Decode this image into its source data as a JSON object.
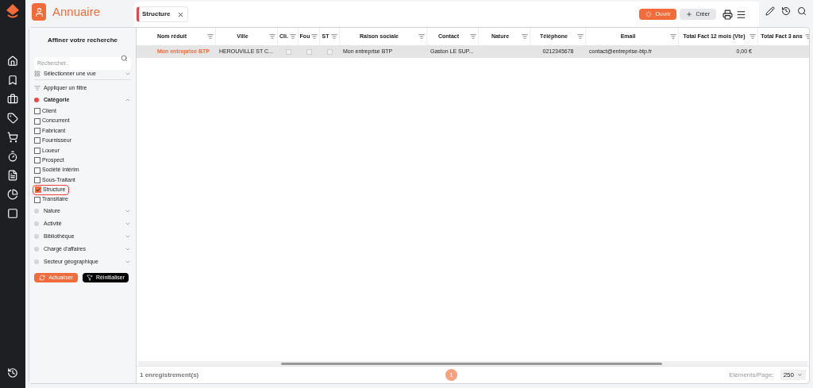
{
  "app": {
    "title": "Annuaire"
  },
  "tabs": [
    {
      "label": "Structure",
      "selected": true
    }
  ],
  "toolbar": {
    "open_button": "Ouvrir",
    "create_button": "Créer"
  },
  "filter_panel": {
    "title": "Affiner votre recherche",
    "search": {
      "placeholder": "Rechercher.."
    },
    "view_select": "Sélectionner une vue",
    "apply_filter": "Appliquer un filtre",
    "groups": [
      {
        "label": "Catégorie",
        "expanded": true,
        "active": true,
        "options": [
          {
            "label": "Client",
            "checked": false
          },
          {
            "label": "Concurrent",
            "checked": false
          },
          {
            "label": "Fabricant",
            "checked": false
          },
          {
            "label": "Fournisseur",
            "checked": false
          },
          {
            "label": "Loueur",
            "checked": false
          },
          {
            "label": "Prospect",
            "checked": false
          },
          {
            "label": "Société Intérim",
            "checked": false
          },
          {
            "label": "Sous-Traitant",
            "checked": false
          },
          {
            "label": "Structure",
            "checked": true
          },
          {
            "label": "Transitaire",
            "checked": false
          }
        ]
      },
      {
        "label": "Nature",
        "expanded": false,
        "active": false
      },
      {
        "label": "Activité",
        "expanded": false,
        "active": false
      },
      {
        "label": "Bibliothèque",
        "expanded": false,
        "active": false
      },
      {
        "label": "Chargé d'affaires",
        "expanded": false,
        "active": false
      },
      {
        "label": "Secteur géographique",
        "expanded": false,
        "active": false
      }
    ],
    "refresh_button": "Actualiser",
    "reset_button": "Réinitialiser"
  },
  "table": {
    "columns": [
      {
        "label": "Nom réduit",
        "kind": "link"
      },
      {
        "label": "Ville",
        "kind": "text"
      },
      {
        "label": "Cli.",
        "kind": "check"
      },
      {
        "label": "Fou",
        "kind": "check"
      },
      {
        "label": "ST",
        "kind": "check"
      },
      {
        "label": "Raison sociale",
        "kind": "text"
      },
      {
        "label": "Contact",
        "kind": "text"
      },
      {
        "label": "Nature",
        "kind": "text"
      },
      {
        "label": "Téléphone",
        "kind": "text"
      },
      {
        "label": "Email",
        "kind": "text"
      },
      {
        "label": "Total Fact 12 mois (Vte)",
        "kind": "text"
      },
      {
        "label": "Total Fact 3 ans",
        "kind": "text"
      }
    ],
    "rows": [
      {
        "selected": true,
        "cells": [
          {
            "text": "Mon entreprise BTP"
          },
          {
            "text": "HEROUVILLE ST C..."
          },
          {
            "checked": false
          },
          {
            "checked": false
          },
          {
            "checked": false
          },
          {
            "text": "Mon entreprise BTP"
          },
          {
            "text": "Gaston LE SUP..."
          },
          {},
          {
            "text": "0212345678"
          },
          {
            "text": "contact@entreprise-btp.fr"
          },
          {
            "text": "0,00 €"
          },
          {}
        ]
      }
    ]
  },
  "footer": {
    "count": "1 enregistrement(s)",
    "pages": [
      {
        "label": "1",
        "selected": true
      }
    ],
    "page_size_label": "Eléments/Page:",
    "page_size": "250"
  }
}
